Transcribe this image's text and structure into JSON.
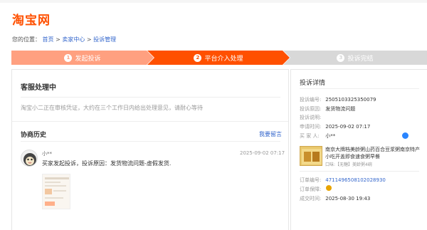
{
  "logo": "淘宝网",
  "breadcrumb": {
    "prefix": "您的位置：",
    "items": [
      "首页",
      "卖家中心",
      "投诉管理"
    ],
    "sep": " > "
  },
  "steps": [
    {
      "num": "1",
      "label": "发起投诉"
    },
    {
      "num": "2",
      "label": "平台介入处理"
    },
    {
      "num": "3",
      "label": "投诉完结"
    }
  ],
  "status": {
    "title": "客服处理中",
    "desc": "淘宝小二正在审核凭证，大约在三个工作日内给出处理意见，请耐心等待"
  },
  "history": {
    "title": "协商历史",
    "leave_message": "我要留言",
    "entries": [
      {
        "user": "小**",
        "time": "2025-09-02 07:17",
        "text": "买家发起投诉，投诉原因：发货物流问题-虚假发货."
      }
    ]
  },
  "details": {
    "title": "投诉详情",
    "complaint_no_label": "投诉编号:",
    "complaint_no": "2505103325350079",
    "reason_label": "投诉原因:",
    "reason": "发货物流问题",
    "desc_label": "投诉说明:",
    "desc": "",
    "time_label": "申请时间:",
    "time": "2025-09-02 07:17",
    "buyer_label": "买 家 人:",
    "buyer": "小**",
    "product_name": "南京大牌档美龄粥山药百合豆浆粥南京特产小吃开盖即食速食粥早餐",
    "product_sku": "口味:【无糖】美龄粥4碗",
    "order_no_label": "订单编号:",
    "order_no": "4711496508102028930",
    "guarantee_label": "订单保障:",
    "deal_time_label": "成交时间:",
    "deal_time": "2025-08-30 19:43"
  },
  "colors": {
    "brand": "#ff5000",
    "link": "#3366cc",
    "step_done": "#ffa080",
    "step_pending": "#d8d8d8"
  }
}
